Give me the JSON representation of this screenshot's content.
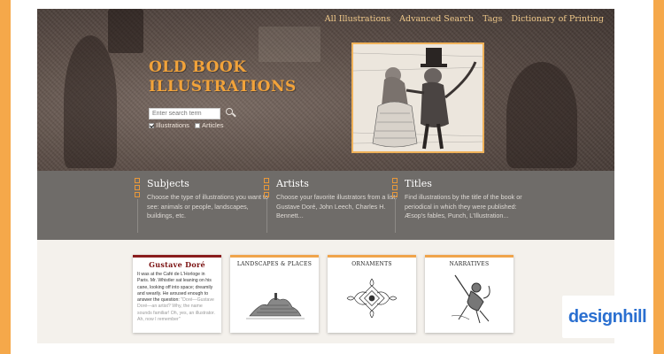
{
  "nav": {
    "items": [
      "All Illustrations",
      "Advanced Search",
      "Tags",
      "Dictionary of Printing"
    ]
  },
  "logo": {
    "line1": "OLD BOOK",
    "line2": "ILLUSTRATIONS"
  },
  "search": {
    "placeholder": "Enter search term",
    "illustrations_label": "Illustrations",
    "illustrations_checked": true,
    "articles_label": "Articles",
    "articles_checked": false
  },
  "sections": [
    {
      "title": "Subjects",
      "text": "Choose the type of illustrations you want to see: animals or people, landscapes, buildings, etc."
    },
    {
      "title": "Artists",
      "text": "Choose your favorite illustrators from a list: Gustave Doré, John Leech, Charles H. Bennett..."
    },
    {
      "title": "Titles",
      "text": "Find illustrations by the title of the book or periodical in which they were published: Æsop's fables, Punch, L'Illustration..."
    }
  ],
  "cards": {
    "doré": {
      "title": "Gustave Doré",
      "text": "It was at the Café de L'Horloge in Paris. Mr. Whistler sat leaning on his cane, looking off into space; dreamily and wearily. He aroused enough to answer the question:",
      "fade": "\"Doré—Gustave Doré—an artist? Why, the name sounds familiar! Oh, yes, an illustrator. Ah, now I remember\""
    },
    "landscapes": "LANDSCAPES & PLACES",
    "ornaments": "ORNAMENTS",
    "narratives": "NARRATIVES"
  },
  "badge": "designhill",
  "colors": {
    "accent": "#f0a44b",
    "logo": "#f2a33a",
    "band": "#6f6c69",
    "border": "#f5a84a"
  }
}
